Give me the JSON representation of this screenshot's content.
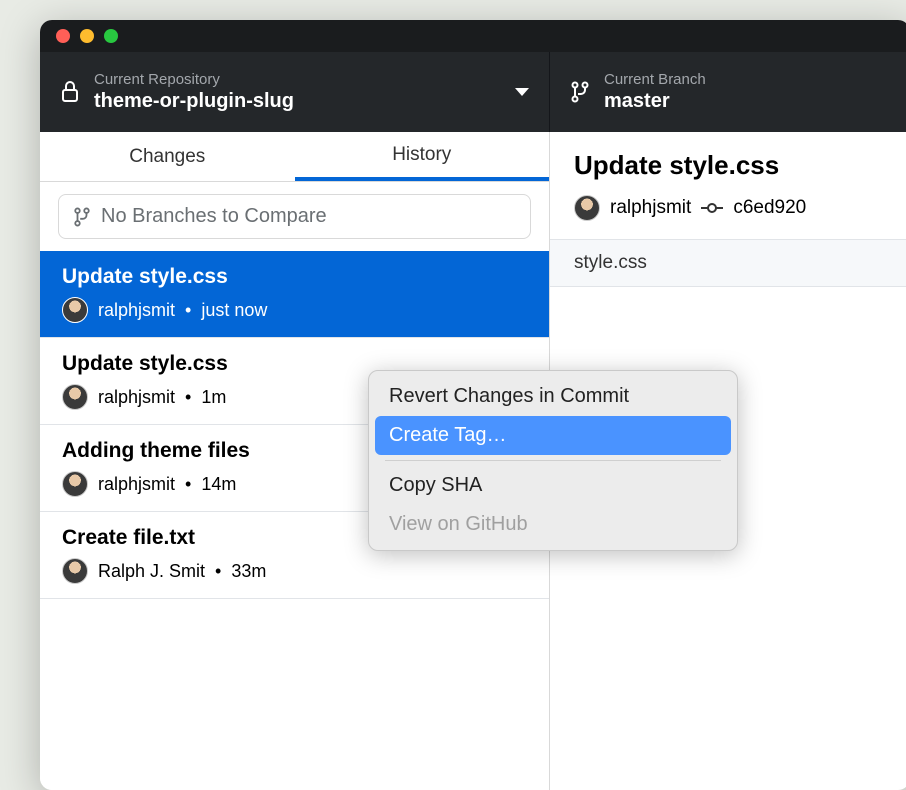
{
  "header": {
    "repository": {
      "label": "Current Repository",
      "value": "theme-or-plugin-slug"
    },
    "branch": {
      "label": "Current Branch",
      "value": "master"
    }
  },
  "tabs": {
    "changes": "Changes",
    "history": "History"
  },
  "compare": {
    "text": "No Branches to Compare"
  },
  "commits": [
    {
      "title": "Update style.css",
      "author": "ralphjsmit",
      "time": "just now",
      "selected": true
    },
    {
      "title": "Update style.css",
      "author": "ralphjsmit",
      "time": "1m",
      "selected": false
    },
    {
      "title": "Adding theme files",
      "author": "ralphjsmit",
      "time": "14m",
      "selected": false
    },
    {
      "title": "Create file.txt",
      "author": "Ralph J. Smit",
      "time": "33m",
      "selected": false
    }
  ],
  "details": {
    "title": "Update style.css",
    "author": "ralphjsmit",
    "sha": "c6ed920",
    "file": "style.css"
  },
  "contextMenu": {
    "items": [
      {
        "label": "Revert Changes in Commit",
        "state": "normal"
      },
      {
        "label": "Create Tag…",
        "state": "highlighted"
      },
      {
        "label": "Copy SHA",
        "state": "normal"
      },
      {
        "label": "View on GitHub",
        "state": "disabled"
      }
    ]
  }
}
